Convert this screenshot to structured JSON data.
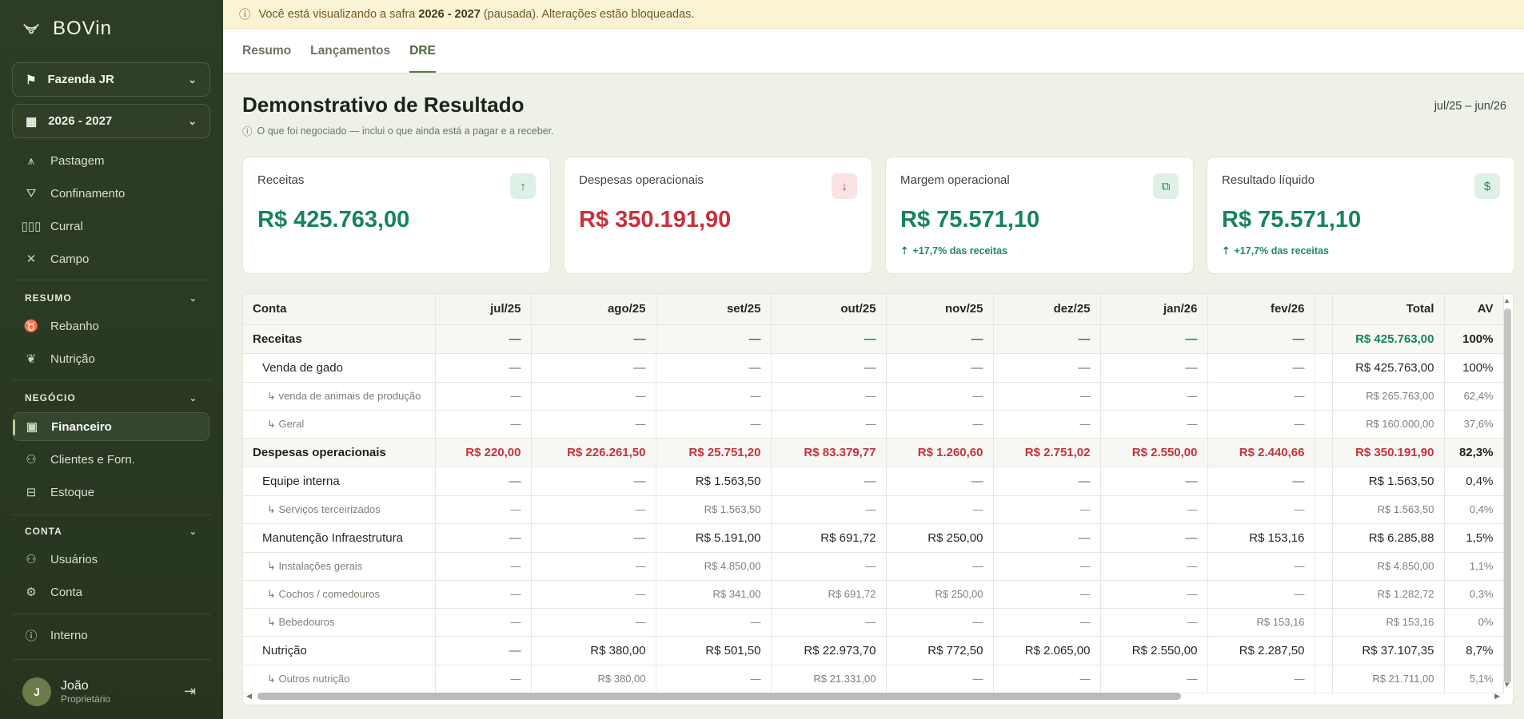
{
  "sidebar": {
    "logo_text": "BOVin",
    "farm": "Fazenda JR",
    "season": "2026 - 2027",
    "nav_top": [
      {
        "label": "Pastagem",
        "icon": "pasture-icon"
      },
      {
        "label": "Confinamento",
        "icon": "feeder-icon"
      },
      {
        "label": "Curral",
        "icon": "corral-icon"
      },
      {
        "label": "Campo",
        "icon": "field-icon"
      }
    ],
    "sections": {
      "resumo": "RESUMO",
      "negocio": "NEGÓCIO",
      "conta": "CONTA"
    },
    "resumo_items": [
      {
        "label": "Rebanho",
        "icon": "cattle-icon"
      },
      {
        "label": "Nutrição",
        "icon": "leaf-icon"
      }
    ],
    "negocio_items": [
      {
        "label": "Financeiro",
        "icon": "wallet-icon"
      },
      {
        "label": "Clientes e Forn.",
        "icon": "users-icon"
      },
      {
        "label": "Estoque",
        "icon": "box-icon"
      }
    ],
    "conta_items": [
      {
        "label": "Usuários",
        "icon": "users-icon"
      },
      {
        "label": "Conta",
        "icon": "gear-icon"
      }
    ],
    "interno": "Interno",
    "user": {
      "initial": "J",
      "name": "João",
      "role": "Proprietário"
    }
  },
  "banner": {
    "prefix": "Você está visualizando a safra ",
    "season": "2026 - 2027",
    "suffix": " (pausada). Alterações estão bloqueadas."
  },
  "tabs": [
    "Resumo",
    "Lançamentos",
    "DRE"
  ],
  "active_tab": "DRE",
  "page": {
    "title": "Demonstrativo de Resultado",
    "subtitle": "O que foi negociado — inclui o que ainda está a pagar e a receber.",
    "period": "jul/25 – jun/26"
  },
  "cards": [
    {
      "label": "Receitas",
      "value": "R$ 425.763,00",
      "tone": "green",
      "icon": "arrow-up-icon",
      "note": ""
    },
    {
      "label": "Despesas operacionais",
      "value": "R$ 350.191,90",
      "tone": "red",
      "icon": "arrow-down-icon",
      "note": ""
    },
    {
      "label": "Margem operacional",
      "value": "R$ 75.571,10",
      "tone": "green",
      "icon": "chart-icon",
      "note": "+17,7% das receitas"
    },
    {
      "label": "Resultado líquido",
      "value": "R$ 75.571,10",
      "tone": "green",
      "icon": "money-bag-icon",
      "note": "+17,7% das receitas"
    }
  ],
  "colors": {
    "green": "#16845a",
    "red": "#c8313b",
    "sidebar": "#2d3d25",
    "banner": "#faf3d4"
  },
  "table": {
    "headers": [
      "Conta",
      "jul/25",
      "ago/25",
      "set/25",
      "out/25",
      "nov/25",
      "dez/25",
      "jan/26",
      "fev/26",
      "",
      "Total",
      "AV"
    ],
    "rows": [
      {
        "kind": "group",
        "tone": "green",
        "cells": [
          "Receitas",
          "—",
          "—",
          "—",
          "—",
          "—",
          "—",
          "—",
          "—",
          "",
          "R$ 425.763,00",
          "100%"
        ]
      },
      {
        "kind": "sub",
        "cells": [
          "Venda de gado",
          "—",
          "—",
          "—",
          "—",
          "—",
          "—",
          "—",
          "—",
          "",
          "R$ 425.763,00",
          "100%"
        ]
      },
      {
        "kind": "leaf",
        "cells": [
          "↳ venda de animais de produção",
          "—",
          "—",
          "—",
          "—",
          "—",
          "—",
          "—",
          "—",
          "",
          "R$ 265.763,00",
          "62,4%"
        ]
      },
      {
        "kind": "leaf",
        "cells": [
          "↳ Geral",
          "—",
          "—",
          "—",
          "—",
          "—",
          "—",
          "—",
          "—",
          "",
          "R$ 160.000,00",
          "37,6%"
        ]
      },
      {
        "kind": "group",
        "tone": "red",
        "cells": [
          "Despesas operacionais",
          "R$ 220,00",
          "R$ 226.261,50",
          "R$ 25.751,20",
          "R$ 83.379,77",
          "R$ 1.260,60",
          "R$ 2.751,02",
          "R$ 2.550,00",
          "R$ 2.440,66",
          "",
          "R$ 350.191,90",
          "82,3%"
        ]
      },
      {
        "kind": "sub",
        "cells": [
          "Equipe interna",
          "—",
          "—",
          "R$ 1.563,50",
          "—",
          "—",
          "—",
          "—",
          "—",
          "",
          "R$ 1.563,50",
          "0,4%"
        ]
      },
      {
        "kind": "leaf",
        "cells": [
          "↳ Serviços terceirizados",
          "—",
          "—",
          "R$ 1.563,50",
          "—",
          "—",
          "—",
          "—",
          "—",
          "",
          "R$ 1.563,50",
          "0,4%"
        ]
      },
      {
        "kind": "sub",
        "cells": [
          "Manutenção Infraestrutura",
          "—",
          "—",
          "R$ 5.191,00",
          "R$ 691,72",
          "R$ 250,00",
          "—",
          "—",
          "R$ 153,16",
          "",
          "R$ 6.285,88",
          "1,5%"
        ]
      },
      {
        "kind": "leaf",
        "cells": [
          "↳ Instalações gerais",
          "—",
          "—",
          "R$ 4.850,00",
          "—",
          "—",
          "—",
          "—",
          "—",
          "",
          "R$ 4.850,00",
          "1,1%"
        ]
      },
      {
        "kind": "leaf",
        "cells": [
          "↳ Cochos / comedouros",
          "—",
          "—",
          "R$ 341,00",
          "R$ 691,72",
          "R$ 250,00",
          "—",
          "—",
          "—",
          "",
          "R$ 1.282,72",
          "0,3%"
        ]
      },
      {
        "kind": "leaf",
        "cells": [
          "↳ Bebedouros",
          "—",
          "—",
          "—",
          "—",
          "—",
          "—",
          "—",
          "R$ 153,16",
          "",
          "R$ 153,16",
          "0%"
        ]
      },
      {
        "kind": "sub",
        "cells": [
          "Nutrição",
          "—",
          "R$ 380,00",
          "R$ 501,50",
          "R$ 22.973,70",
          "R$ 772,50",
          "R$ 2.065,00",
          "R$ 2.550,00",
          "R$ 2.287,50",
          "",
          "R$ 37.107,35",
          "8,7%"
        ]
      },
      {
        "kind": "leaf",
        "cells": [
          "↳ Outros nutrição",
          "—",
          "R$ 380,00",
          "—",
          "R$ 21.331,00",
          "—",
          "—",
          "—",
          "—",
          "",
          "R$ 21.711,00",
          "5,1%"
        ]
      }
    ]
  }
}
